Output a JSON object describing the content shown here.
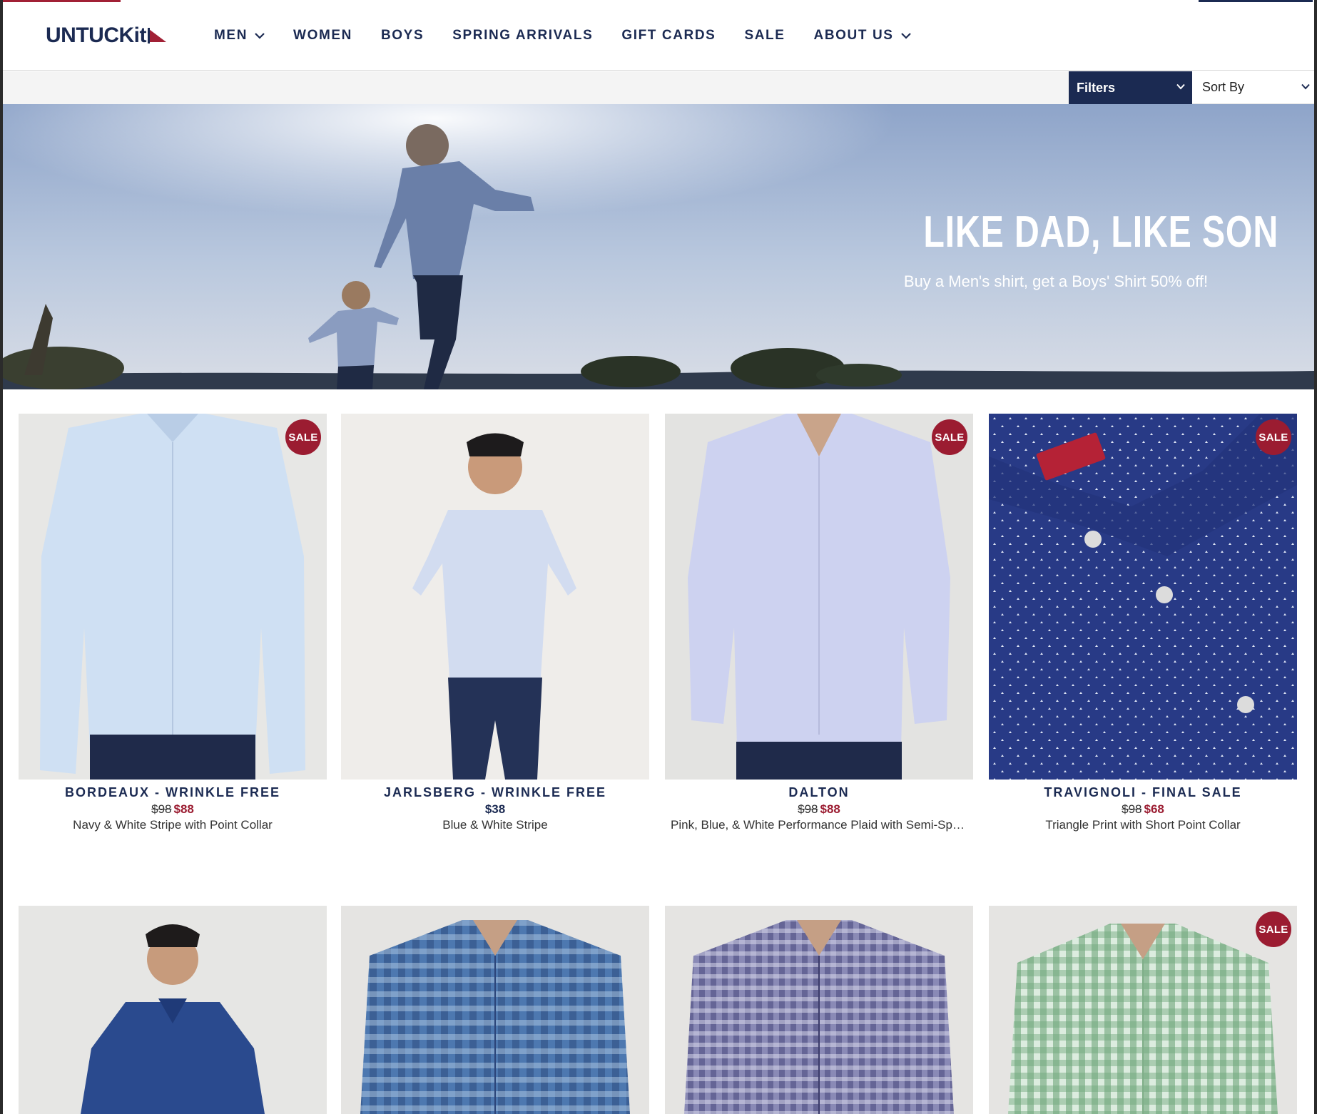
{
  "brand": {
    "logo_text": "UNTUCKit"
  },
  "nav": {
    "items": [
      {
        "label": "MEN",
        "has_dropdown": true
      },
      {
        "label": "WOMEN",
        "has_dropdown": false
      },
      {
        "label": "BOYS",
        "has_dropdown": false
      },
      {
        "label": "SPRING ARRIVALS",
        "has_dropdown": false
      },
      {
        "label": "GIFT CARDS",
        "has_dropdown": false
      },
      {
        "label": "SALE",
        "has_dropdown": false
      },
      {
        "label": "ABOUT US",
        "has_dropdown": true
      }
    ]
  },
  "toolbar": {
    "filters_label": "Filters",
    "sort_label": "Sort By"
  },
  "hero": {
    "title": "LIKE DAD, LIKE SON",
    "subtitle": "Buy a Men's shirt, get a Boys' Shirt 50% off!"
  },
  "colors": {
    "brand_navy": "#1b2a52",
    "sale_red": "#9b1c31",
    "filter_bar_bg": "#f4f4f4"
  },
  "products": [
    {
      "name": "BORDEAUX - WRINKLE FREE",
      "was_price": "$98",
      "price": "$88",
      "desc": "Navy & White Stripe with Point Collar",
      "sale": true,
      "badge": "SALE",
      "shirt_color": "#cfe0f3"
    },
    {
      "name": "JARLSBERG - WRINKLE FREE",
      "was_price": "",
      "price": "$38",
      "desc": "Blue & White Stripe",
      "sale": false,
      "badge": "",
      "shirt_color": "#d2dcf0"
    },
    {
      "name": "DALTON",
      "was_price": "$98",
      "price": "$88",
      "desc": "Pink, Blue, & White Performance Plaid with Semi-Spread Collar",
      "sale": true,
      "badge": "SALE",
      "shirt_color": "#cdd2f0"
    },
    {
      "name": "TRAVIGNOLI - FINAL SALE",
      "was_price": "$98",
      "price": "$68",
      "desc": "Triangle Print with Short Point Collar",
      "sale": true,
      "badge": "SALE",
      "shirt_color": "#283a86"
    },
    {
      "name": "",
      "was_price": "",
      "price": "",
      "desc": "",
      "sale": false,
      "badge": "",
      "shirt_color": "#2a4a8e"
    },
    {
      "name": "",
      "was_price": "",
      "price": "",
      "desc": "",
      "sale": false,
      "badge": "",
      "shirt_color": "#4d78b0"
    },
    {
      "name": "",
      "was_price": "",
      "price": "",
      "desc": "",
      "sale": false,
      "badge": "",
      "shirt_color": "#6e6e9e"
    },
    {
      "name": "",
      "was_price": "",
      "price": "",
      "desc": "",
      "sale": true,
      "badge": "SALE",
      "shirt_color": "#8fbf98"
    }
  ]
}
